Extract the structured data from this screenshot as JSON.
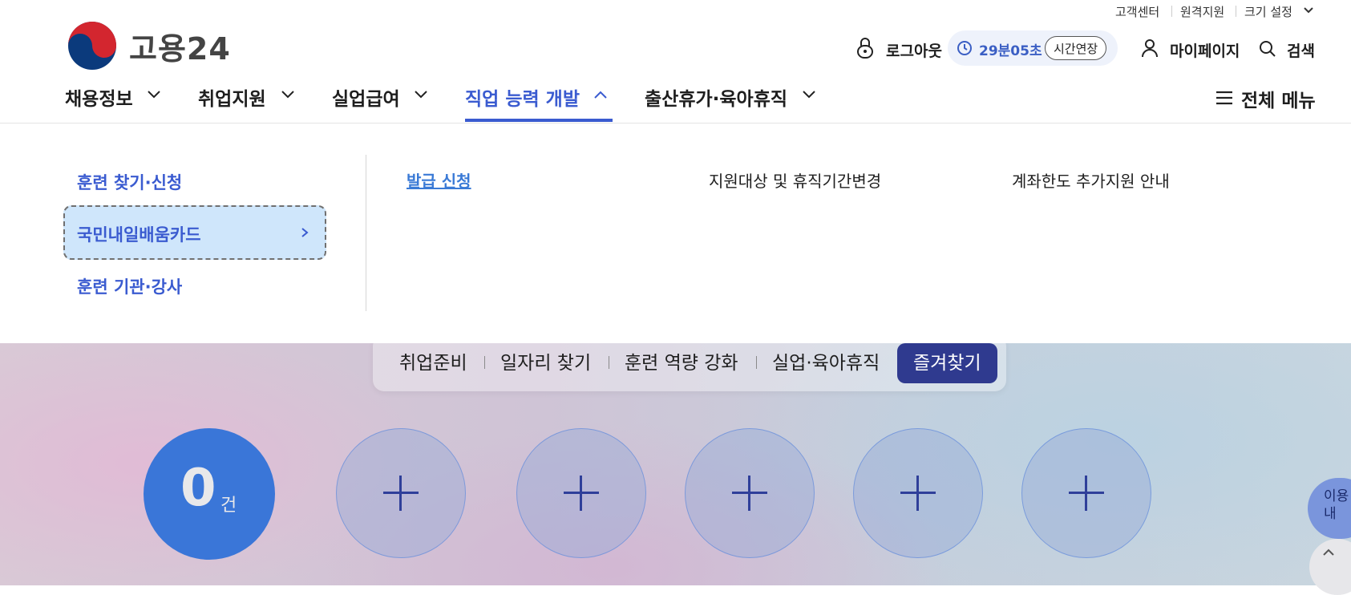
{
  "utility": {
    "customer_center": "고객센터",
    "remote_support": "원격지원",
    "font_size": "크기 설정"
  },
  "logo": {
    "text": "고용24"
  },
  "header": {
    "logout": "로그아웃",
    "timer": "29분05초",
    "extend": "시간연장",
    "mypage": "마이페이지",
    "search": "검색",
    "all_menu": "전체 메뉴"
  },
  "gnb": [
    {
      "label": "채용정보"
    },
    {
      "label": "취업지원"
    },
    {
      "label": "실업급여"
    },
    {
      "label": "직업 능력 개발"
    },
    {
      "label": "출산휴가·육아휴직"
    }
  ],
  "dropdown": {
    "level2": [
      {
        "label": "훈련 찾기·신청"
      },
      {
        "label": "국민내일배움카드"
      },
      {
        "label": "훈련 기관·강사"
      }
    ],
    "level3": [
      {
        "label": "발급 신청"
      },
      {
        "label": "지원대상 및 휴직기간변경"
      },
      {
        "label": "계좌한도 추가지원 안내"
      }
    ]
  },
  "quick_tabs": [
    {
      "label": "취업준비"
    },
    {
      "label": "일자리 찾기"
    },
    {
      "label": "훈련 역량 강화"
    },
    {
      "label": "실업·육아휴직"
    },
    {
      "label": "즐겨찾기"
    }
  ],
  "favorites": {
    "count": "0",
    "unit": "건"
  },
  "floating": {
    "guide": "이용 안내"
  },
  "colors": {
    "accent": "#3a5bd0",
    "favorite_active": "#2f3a8f",
    "count_circle": "#3a76d8"
  }
}
